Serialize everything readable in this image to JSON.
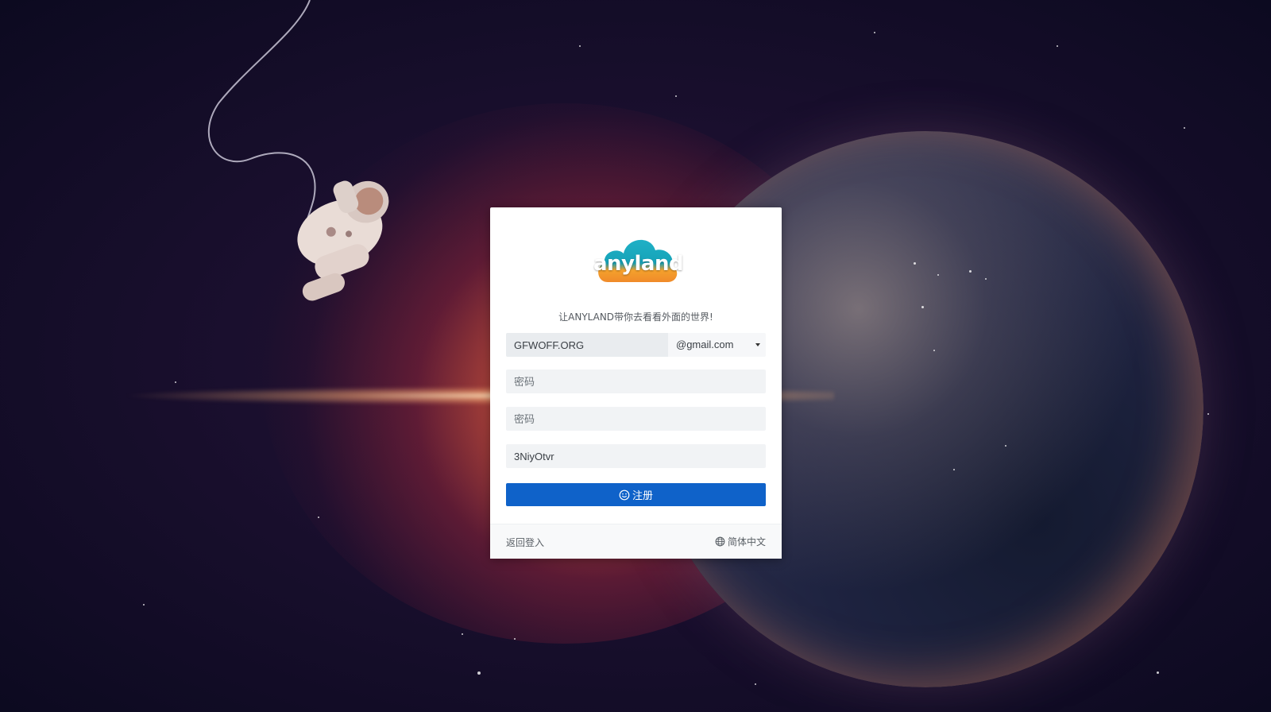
{
  "brand": {
    "logo_text": "anyland",
    "cloud_top_color": "#1fb0c6",
    "cloud_bottom_color": "#f4a12c"
  },
  "form": {
    "tagline": "让ANYLAND带你去看看外面的世界!",
    "email_value": "GFWOFF.ORG",
    "email_domain": "@gmail.com",
    "password_placeholder": "密码",
    "confirm_password_placeholder": "密码",
    "invite_value": "3NiyOtvr",
    "submit_label": "注册",
    "submit_color": "#0f62c9"
  },
  "footer": {
    "back_label": "返回登入",
    "language_label": "简体中文"
  },
  "icons": {
    "submit_icon": "smile-icon",
    "language_icon": "globe-icon",
    "dropdown_icon": "caret-down-icon"
  }
}
